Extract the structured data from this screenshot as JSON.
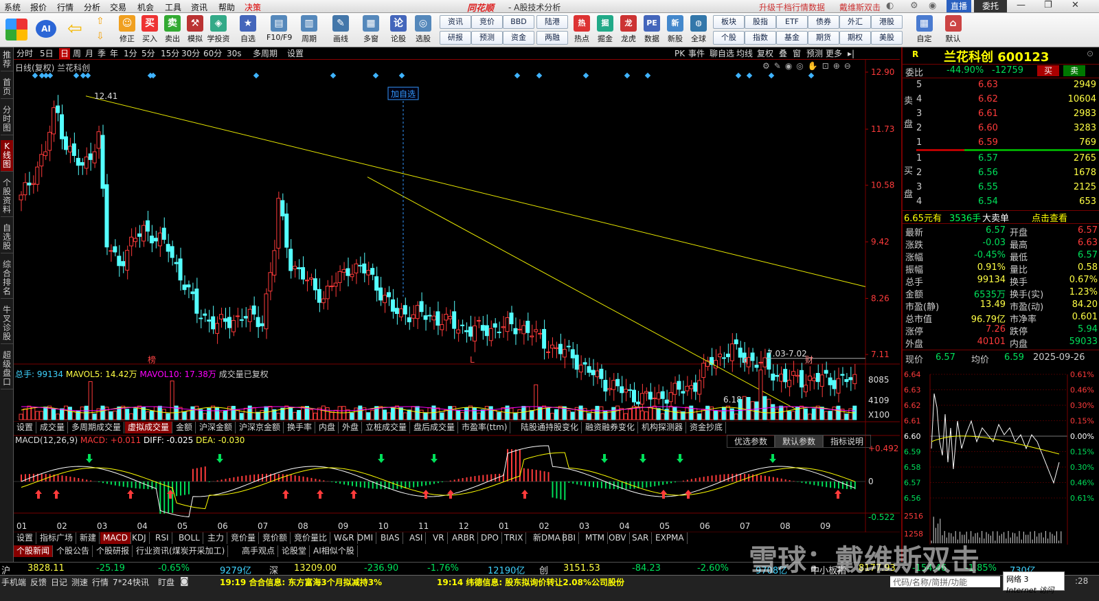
{
  "menu": {
    "items": [
      "系统",
      "报价",
      "行情",
      "分析",
      "交易",
      "机会",
      "工具",
      "资讯",
      "帮助",
      "决策"
    ],
    "brand": "同花顺",
    "subtitle": "- A股技术分析",
    "right": [
      "升级千档行情数据",
      "戴维斯双击"
    ],
    "live": "直播",
    "entrust": "委托"
  },
  "toolbar": {
    "tools": [
      "修正",
      "买入",
      "卖出",
      "模拟",
      "学投资",
      "自选",
      "F10/F9",
      "周期",
      "画线",
      "多窗",
      "论股",
      "选股"
    ],
    "btns": [
      [
        "资讯",
        "竞价",
        "BBD",
        "陆港",
        "债券",
        "外汇",
        "港股"
      ],
      [
        "研报",
        "预测",
        "资金",
        "两融",
        "热点",
        "掘金",
        "龙虎",
        "数据",
        "新股",
        "全球",
        "个股",
        "指数",
        "基金",
        "期货",
        "期权",
        "美股"
      ]
    ],
    "row1b": [
      "板块",
      "股指",
      "ETF",
      "债券",
      "外汇",
      "港股"
    ],
    "extra": [
      "自定",
      "默认"
    ],
    "ai": "AI"
  },
  "leftnav": [
    "推荐",
    "首页",
    "分时图",
    "K线图",
    "个股资料",
    "自选股",
    "综合排名",
    "牛叉诊股",
    "超级盘口"
  ],
  "period": {
    "items": [
      "分时",
      "5日",
      "日",
      "周",
      "月",
      "季",
      "年",
      "1分",
      "5分",
      "15分",
      "30分",
      "60分",
      "30s",
      "多周期",
      "设置"
    ],
    "right": [
      "PK",
      "事件",
      "聊自选",
      "均线",
      "复权",
      "叠",
      "窗",
      "预测",
      "更多"
    ]
  },
  "kline": {
    "title": "日线(复权) 兰花科创",
    "prices": [
      "12.90",
      "11.73",
      "10.58",
      "9.42",
      "8.26",
      "7.11"
    ],
    "high_label": "12.41",
    "low_label": "6.18",
    "range_label": "7.03-7.02",
    "add_label": "加自选",
    "markers": [
      "榜",
      "L",
      "q",
      "财"
    ]
  },
  "volume": {
    "label": "总手: 99134",
    "mavol5": "MAVOL5: 14.42万",
    "mavol10": "MAVOL10: 17.38万",
    "note": "成交量已复权",
    "axis": [
      "8085",
      "4109",
      "X100"
    ]
  },
  "voltabs": [
    "设置",
    "成交量",
    "多周期成交量",
    "虚拟成交量",
    "金额",
    "沪深金额",
    "沪深京金额",
    "换手率",
    "内盘",
    "外盘",
    "立桩成交量",
    "盘后成交量",
    "市盈率(ttm)",
    "陆股通持股变化",
    "融资融券变化",
    "机构探测器",
    "资金抄底"
  ],
  "macd": {
    "title": "MACD(12,26,9)",
    "macd": "MACD: +0.011",
    "diff": "DIFF: -0.025",
    "dea": "DEA: -0.030",
    "axis": [
      "+0.492",
      "0",
      "-0.522"
    ],
    "params": [
      "优选参数",
      "默认参数",
      "指标说明"
    ]
  },
  "months": [
    "01",
    "02",
    "03",
    "04",
    "05",
    "06",
    "07",
    "08",
    "09",
    "10",
    "11",
    "12",
    "01",
    "02",
    "03",
    "04",
    "05",
    "06",
    "07",
    "08",
    "09"
  ],
  "indtabs": [
    "设置",
    "指标广场",
    "新建",
    "MACD",
    "KDJ",
    "RSI",
    "BOLL",
    "主力",
    "竞价量",
    "竞价额",
    "竞价量比",
    "W&R",
    "DMI",
    "BIAS",
    "ASI",
    "VR",
    "ARBR",
    "DPO",
    "TRIX",
    "新DMA",
    "BBI",
    "MTM",
    "OBV",
    "SAR",
    "EXPMA"
  ],
  "newsTabs": [
    "个股新闻",
    "个股公告",
    "个股研报",
    "行业资讯(煤炭开采加工)",
    "高手观点",
    "论股堂",
    "AI相似个股"
  ],
  "quote": {
    "name": "兰花科创 600123",
    "weibi": "委比",
    "wb_val": "-44.90%",
    "wb_num": "-12759",
    "buy": "买",
    "sell": "卖",
    "asks": [
      [
        "5",
        "6.63",
        "2949"
      ],
      [
        "4",
        "6.62",
        "10604"
      ],
      [
        "3",
        "6.61",
        "2983"
      ],
      [
        "2",
        "6.60",
        "3283"
      ],
      [
        "1",
        "6.59",
        "769"
      ]
    ],
    "bids": [
      [
        "1",
        "6.57",
        "2765"
      ],
      [
        "2",
        "6.56",
        "1678"
      ],
      [
        "3",
        "6.55",
        "2125"
      ],
      [
        "4",
        "6.54",
        "653"
      ]
    ],
    "sellside": "卖盘",
    "buyside": "买盘",
    "bigorder": [
      "6.65元有",
      "3536手",
      "大卖单",
      "点击查看"
    ],
    "stats": [
      [
        "最新",
        "6.57",
        "开盘",
        "6.57"
      ],
      [
        "涨跌",
        "-0.03",
        "最高",
        "6.63"
      ],
      [
        "涨幅",
        "-0.45%",
        "最低",
        "6.57"
      ],
      [
        "振幅",
        "0.91%",
        "量比",
        "0.58"
      ],
      [
        "总手",
        "99134",
        "换手",
        "0.67%"
      ],
      [
        "金额",
        "6535万",
        "换手(实)",
        "1.23%"
      ],
      [
        "市盈(静)",
        "13.49",
        "市盈(动)",
        "84.20"
      ],
      [
        "总市值",
        "96.79亿",
        "市净率",
        "0.601"
      ],
      [
        "涨停",
        "7.26",
        "跌停",
        "5.94"
      ],
      [
        "外盘",
        "40101",
        "内盘",
        "59033"
      ]
    ],
    "now_label": "现价",
    "now": "6.57",
    "avg_label": "均价",
    "avg": "6.59",
    "date": "2025-09-26",
    "mini_left": [
      "6.64",
      "6.63",
      "6.62",
      "6.61",
      "6.60",
      "6.59",
      "6.58",
      "6.57",
      "6.56"
    ],
    "mini_right": [
      "0.61%",
      "0.46%",
      "0.30%",
      "0.15%",
      "0.00%",
      "0.15%",
      "0.30%",
      "0.46%",
      "0.61%"
    ],
    "mini_vol": [
      "2516",
      "1258"
    ]
  },
  "indexbar": [
    [
      "沪",
      "3828.11",
      "-25.19",
      "-0.65%",
      "9279亿"
    ],
    [
      "深",
      "13209.00",
      "-236.90",
      "-1.76%",
      "12190亿"
    ],
    [
      "创",
      "3151.53",
      "-84.23",
      "-2.60%",
      "9708亿"
    ],
    [
      "中小板指",
      "8177.93",
      "-154.46",
      "-1.85%",
      "730亿"
    ]
  ],
  "status": {
    "left": [
      "手机端",
      "反馈",
      "日记",
      "测速",
      "行情",
      "7*24快讯",
      "盯盘"
    ],
    "news1": "19:19 合合信息: 东方富海3个月拟减持3%",
    "news2": "19:14 纬德信息: 股东拟询价转让2.08%公司股份",
    "search": "代码/名称/简拼/功能",
    "net": "网络 3",
    "internet": "Internet 访问",
    "time": ":28"
  },
  "watermark": "雪球：戴维斯双击"
}
